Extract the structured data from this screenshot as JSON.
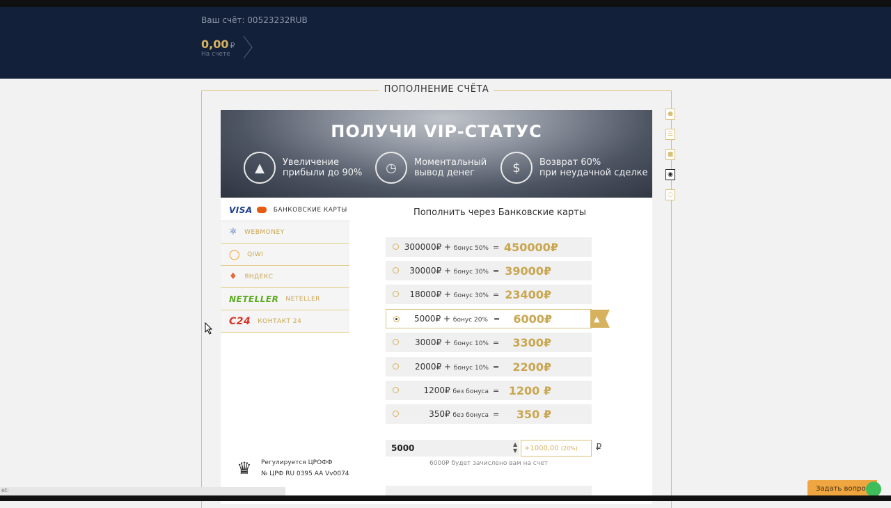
{
  "header": {
    "account_label": "Ваш счёт: 00523232RUB",
    "balance": "0,00",
    "currency_symbol": "₽",
    "balance_sub": "На счете"
  },
  "panel": {
    "title": "ПОПОЛНЕНИЕ СЧЁТА"
  },
  "side_icons": [
    "user-icon",
    "checklist-icon",
    "lock-icon",
    "wallet-icon",
    "pin-icon"
  ],
  "banner": {
    "title": "ПОЛУЧИ VIP-СТАТУС",
    "features": [
      {
        "icon": "growth-chart-icon",
        "line1": "Увеличение",
        "line2": "прибыли до 90%"
      },
      {
        "icon": "clock-icon",
        "line1": "Моментальный",
        "line2": "вывод денег"
      },
      {
        "icon": "dollar-coin-icon",
        "line1": "Возврат 60%",
        "line2": "при неудачной сделке"
      }
    ]
  },
  "methods": [
    {
      "logo": "VISA",
      "label": "БАНКОВСКИЕ КАРТЫ",
      "active": true
    },
    {
      "logo": "",
      "label": "WEBMONEY",
      "active": false
    },
    {
      "logo": "",
      "label": "QIWI",
      "active": false
    },
    {
      "logo": "",
      "label": "ЯНДЕКС",
      "active": false
    },
    {
      "logo": "NETELLER",
      "label": "NETELLER",
      "active": false
    },
    {
      "logo": "C24",
      "label": "КОНТАКТ 24",
      "active": false
    }
  ],
  "pay_title": "Пополнить через Банковские карты",
  "packages": [
    {
      "amount": "300000₽ +",
      "bonus": "бонус 50%",
      "eq": "=",
      "total": "450000₽"
    },
    {
      "amount": "30000₽ +",
      "bonus": "бонус 30%",
      "eq": "=",
      "total": "39000₽"
    },
    {
      "amount": "18000₽ +",
      "bonus": "бонус 30%",
      "eq": "=",
      "total": "23400₽"
    },
    {
      "amount": "5000₽ +",
      "bonus": "бонус 20%",
      "eq": "=",
      "total": "6000₽"
    },
    {
      "amount": "3000₽ +",
      "bonus": "бонус 10%",
      "eq": "=",
      "total": "3300₽"
    },
    {
      "amount": "2000₽ +",
      "bonus": "бонус 10%",
      "eq": "=",
      "total": "2200₽"
    },
    {
      "amount": "1200₽",
      "bonus": "без бонуса",
      "eq": "=",
      "total": "1200 ₽"
    },
    {
      "amount": "350₽",
      "bonus": "без бонуса",
      "eq": "=",
      "total": "350 ₽"
    }
  ],
  "selected_package": 3,
  "amount_input": {
    "value": "5000",
    "bonus_value": "+1000,00",
    "bonus_pct": "(20%)",
    "currency": "₽",
    "note": "6000₽ будет зачислено вам на счет"
  },
  "regulation": {
    "line1": "Регулируется ЦРОФФ",
    "line2": "№ ЦРФ RU 0395 AA Vv0074"
  },
  "ask_button": "Задать вопрос",
  "status_text": "et:"
}
